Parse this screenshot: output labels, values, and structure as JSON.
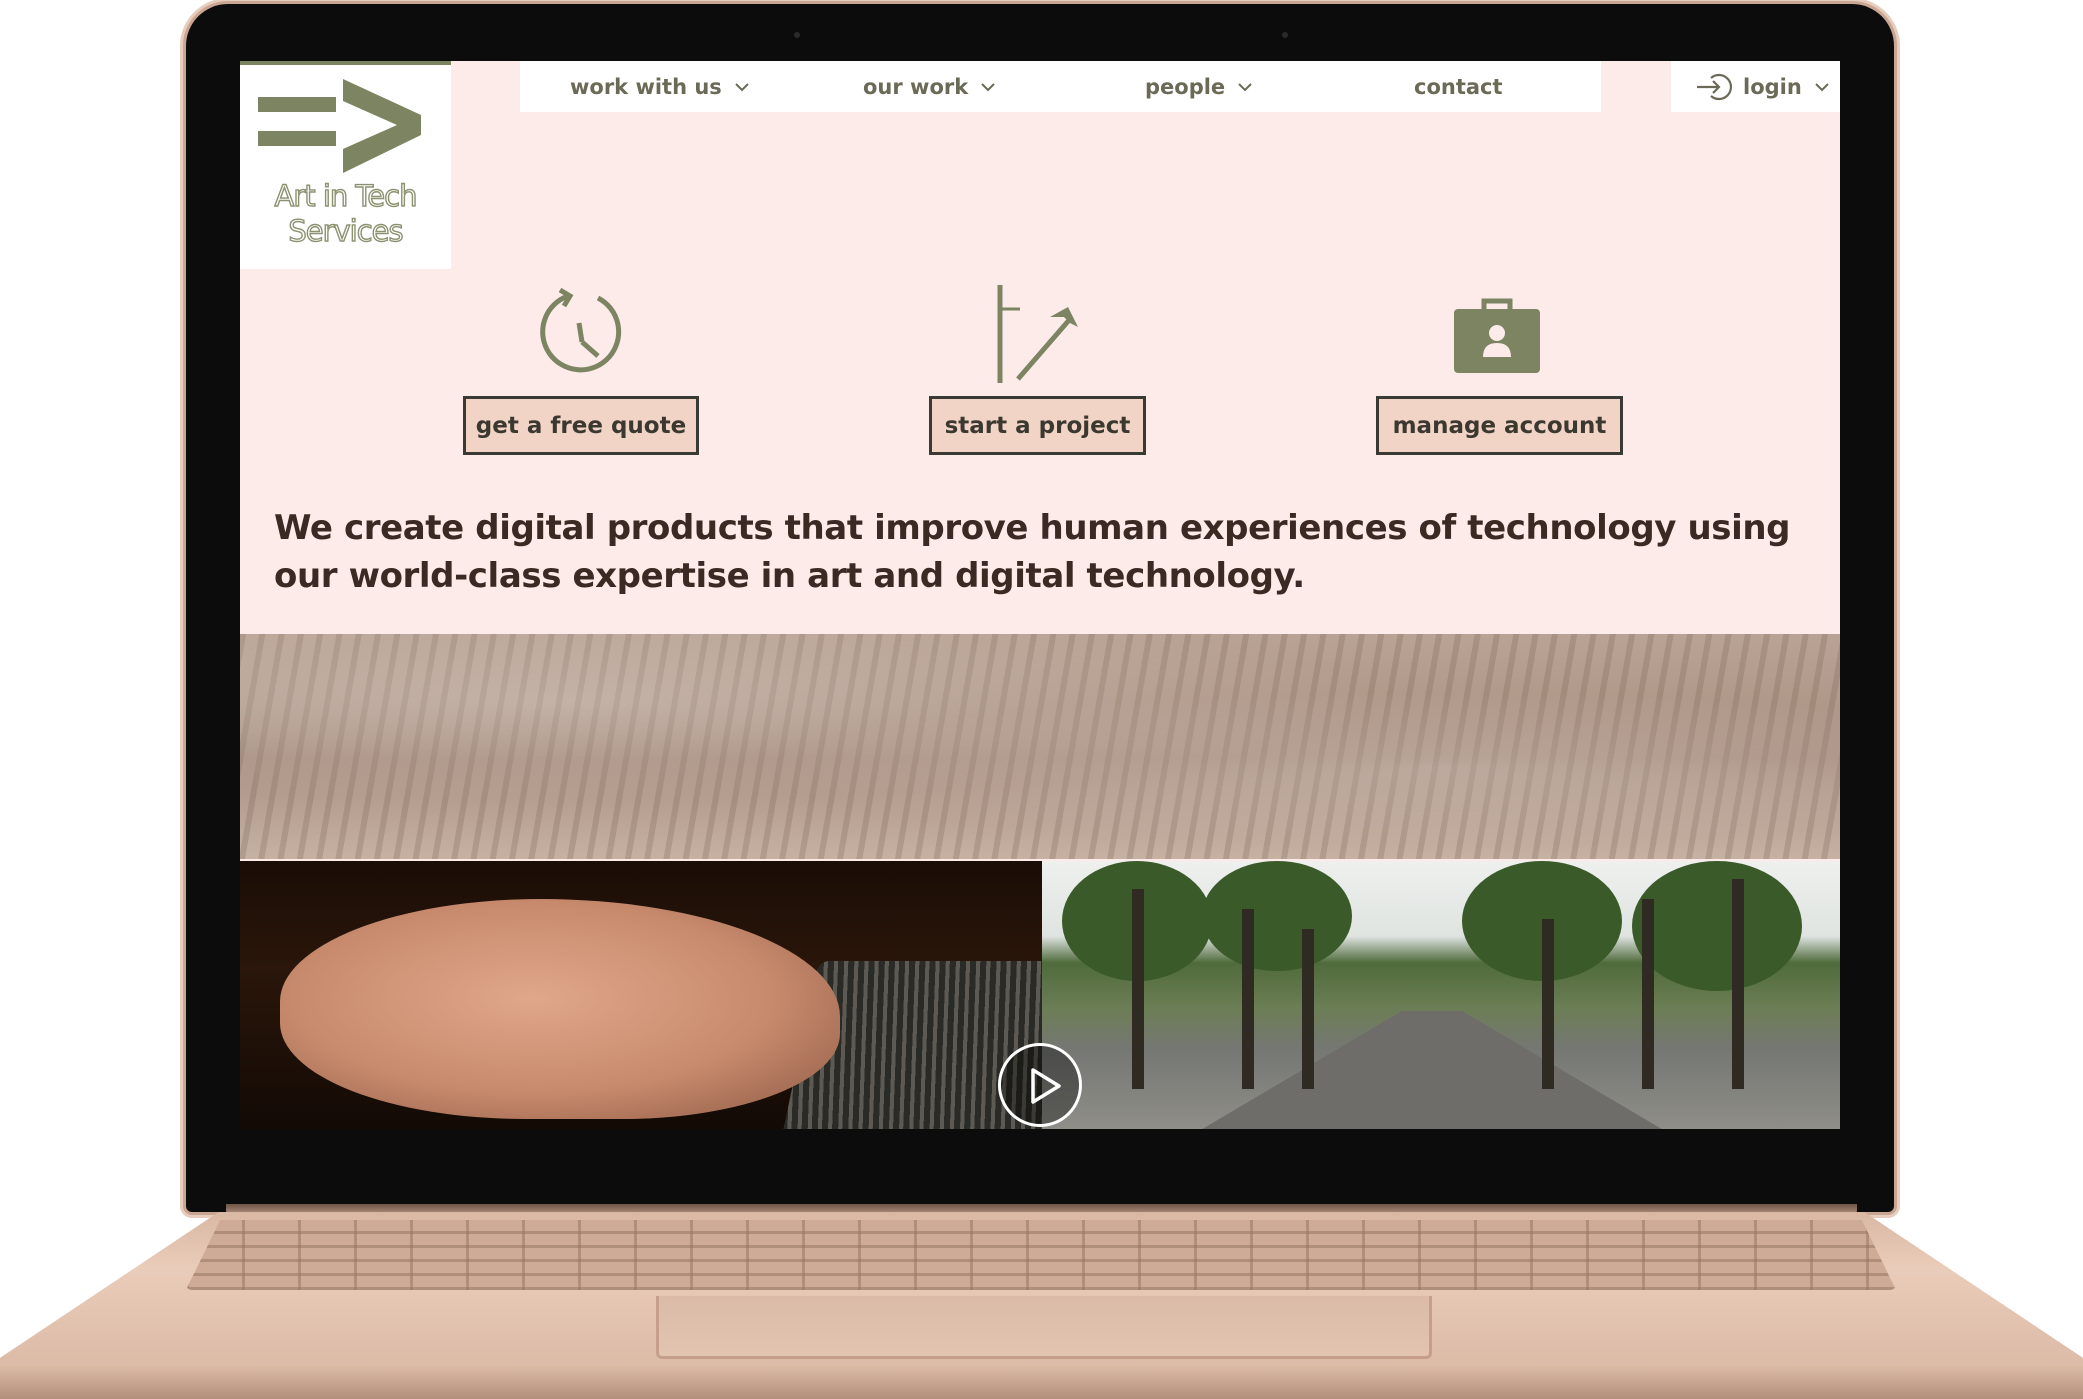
{
  "logo": {
    "line1": "Art in Tech",
    "line2": "Services"
  },
  "nav": {
    "work_with_us": "work with us",
    "our_work": "our work",
    "people": "people",
    "contact": "contact",
    "login": "login"
  },
  "actions": {
    "quote": {
      "label": "get a free quote",
      "icon": "clock-icon"
    },
    "project": {
      "label": "start a project",
      "icon": "tools-icon"
    },
    "account": {
      "label": "manage account",
      "icon": "briefcase-user-icon"
    }
  },
  "tagline": "We create digital products that improve human experiences of technology using our world-class expertise in art and digital technology.",
  "colors": {
    "accent": "#7c8462",
    "page_bg": "#fcebe9",
    "button_bg": "#f1d4c5",
    "text_dark": "#3a2a23",
    "nav_text": "#6b6a57"
  }
}
